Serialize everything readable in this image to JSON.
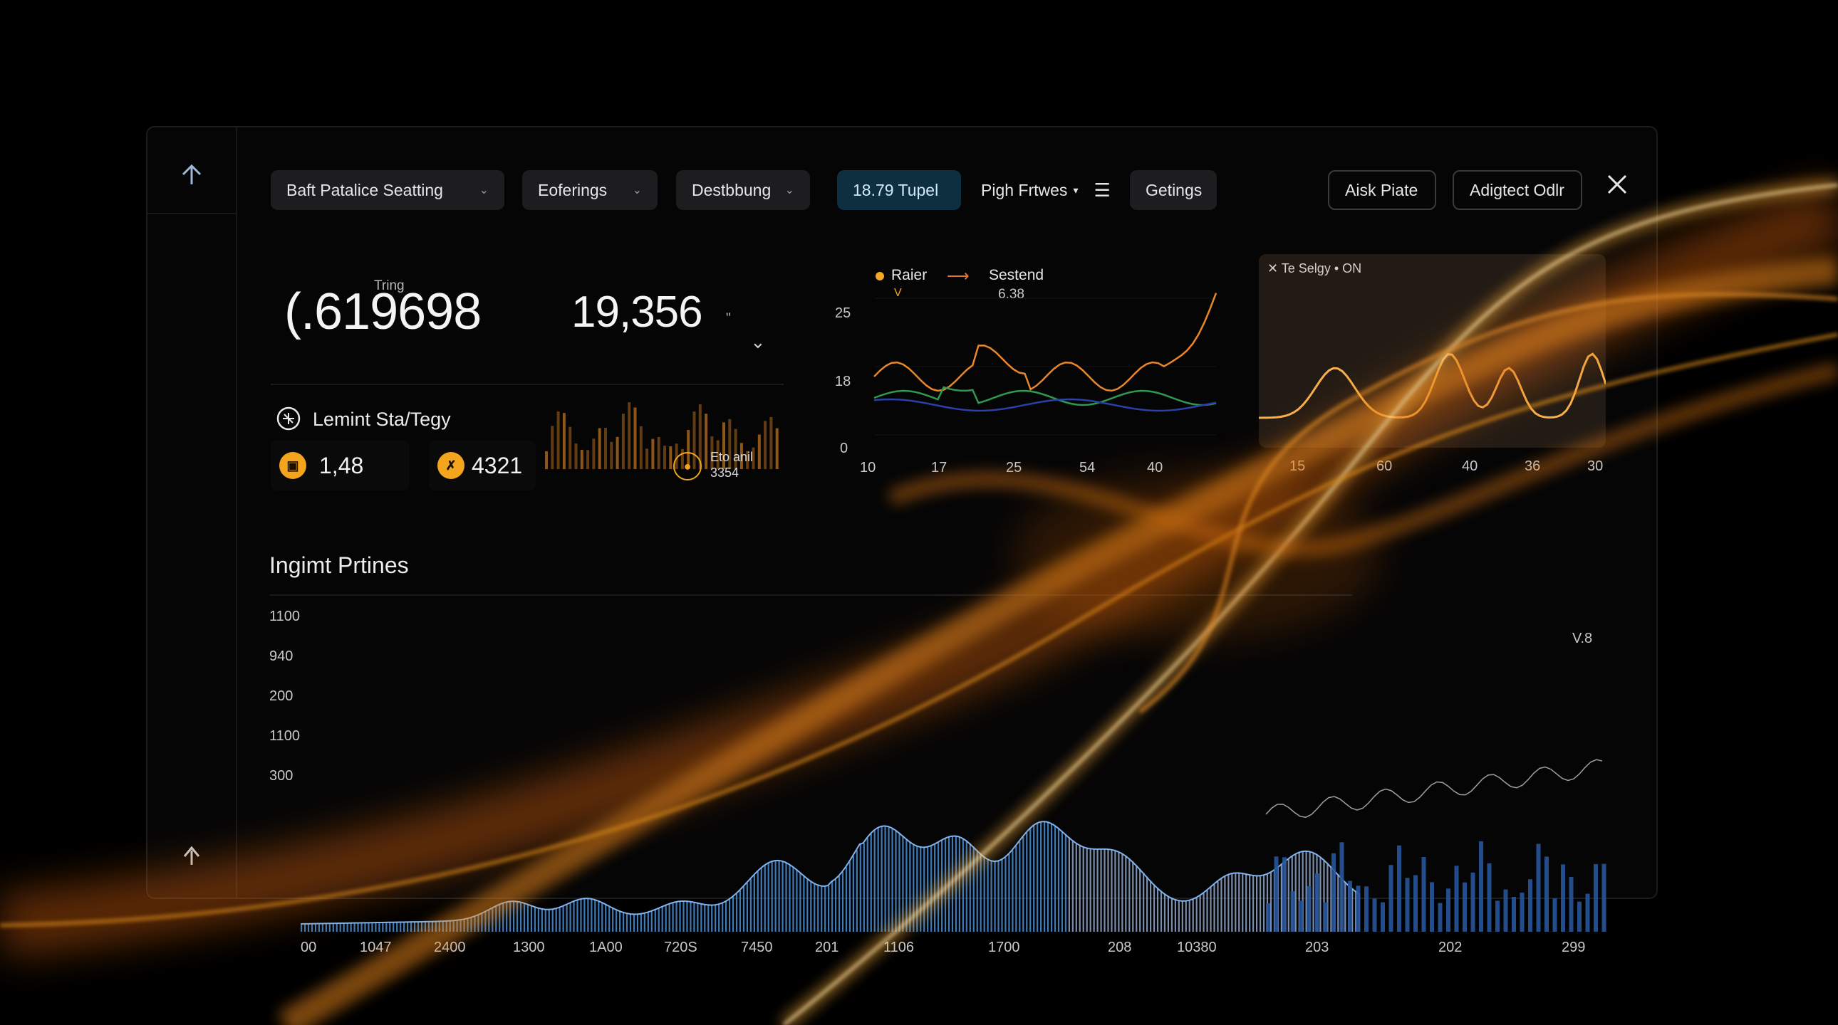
{
  "toolbar": {
    "dropdown1": "Baft Patalice Seatting",
    "dropdown2": "Eoferings",
    "dropdown3": "Destbbung",
    "accent_button": "18.79 Tupel",
    "filter_label": "Pigh Frtwes",
    "settings": "Getings",
    "ask_button": "Aisk Piate",
    "adjust_button": "Adigtect Odlr"
  },
  "metrics": {
    "main_value": "(.619698",
    "main_label": "Tring",
    "secondary_value": "19,356",
    "secondary_unit": "\"",
    "strategy_title": "Lemint Sta/Tegy",
    "stat1": "1,48",
    "stat2": "4321",
    "stat3_line1": "Eto anil",
    "stat3_line2": "3354"
  },
  "line_chart": {
    "legend1": "Raier",
    "legend2": "Sestend",
    "legend2_value": "6.38",
    "y_ticks": [
      "25",
      "18",
      "0"
    ],
    "x_ticks": [
      "10",
      "17",
      "25",
      "54",
      "40"
    ]
  },
  "glass_panel": {
    "header": "Te Selgy • ON",
    "x_ticks": [
      "15",
      "60",
      "40",
      "36",
      "30"
    ]
  },
  "bottom": {
    "title": "Ingimt Prtines",
    "y_ticks": [
      "1100",
      "940",
      "200",
      "1100",
      "300"
    ],
    "x_ticks": [
      "00",
      "1047",
      "2400",
      "1300",
      "1A00",
      "720S",
      "7450",
      "201",
      "1106",
      "1700",
      "208",
      "10380"
    ],
    "right_x_ticks": [
      "203",
      "202",
      "299"
    ],
    "right_label": "V.8"
  },
  "colors": {
    "accent_blue": "#4a8fd8",
    "orange": "#f59a1b",
    "green": "#3aa35a",
    "navy": "#2d3fa8"
  },
  "icons": [
    "up-arrow-icon",
    "upload-icon",
    "chevron-down-icon",
    "menu-icon",
    "close-icon",
    "strategy-icon",
    "coin-icon"
  ]
}
